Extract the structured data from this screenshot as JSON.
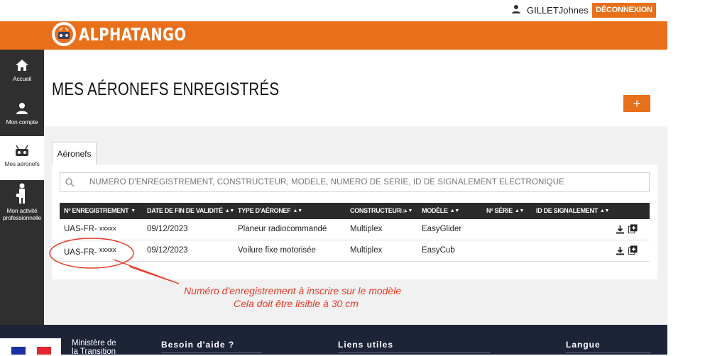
{
  "topbar": {
    "user_name": "GILLETJohnes",
    "logout_label": "DÉCONNEXION"
  },
  "header": {
    "logo_text": "ALPHATANGO"
  },
  "sidebar": {
    "items": [
      {
        "label": "Accueil",
        "icon": "home-icon"
      },
      {
        "label": "Mon compte",
        "icon": "user-icon"
      },
      {
        "label": "Mes aéronefs",
        "icon": "drone-icon"
      },
      {
        "label": "Mon activité professionnelle",
        "label_l1": "Mon activité",
        "label_l2": "professionnelle",
        "icon": "professional-icon"
      }
    ]
  },
  "main": {
    "title": "MES AÉRONEFS ENREGISTRÉS",
    "add_label": "+",
    "tab_label": "Aéronefs",
    "search_placeholder": "NUMÉRO D'ENREGISTREMENT, CONSTRUCTEUR, MODÈLE, NUMÉRO DE SÉRIE, ID DE SIGNALEMENT ÉLECTRONIQUE"
  },
  "table": {
    "columns": [
      "Nº ENREGISTREMENT",
      "DATE DE FIN DE VALIDITÉ",
      "TYPE D'AÉRONEF",
      "CONSTRUCTEUR",
      "MODÈLE",
      "Nº SÉRIE",
      "ID DE SIGNALEMENT"
    ],
    "ghost_text": "xte",
    "rows": [
      {
        "reg_prefix": "UAS-FR-",
        "reg_mask": "xxxxx",
        "date": "09/12/2023",
        "type": "Planeur radiocommandé",
        "maker": "Multiplex",
        "model": "EasyGlider",
        "serial": "",
        "signal_id": ""
      },
      {
        "reg_prefix": "UAS-FR-",
        "reg_mask": "xxxxx",
        "date": "09/12/2023",
        "type": "Voilure fixe motorisée",
        "maker": "Multiplex",
        "model": "EasyCub",
        "serial": "",
        "signal_id": ""
      }
    ]
  },
  "annotation": {
    "line1": "Numéro d'enregistrement à inscrire sur le modèle",
    "line2": "Cela doit être lisible à 30 cm",
    "color": "#e63a25"
  },
  "footer": {
    "ministry_l1": "Ministère de",
    "ministry_l2": "la Transition",
    "help_title": "Besoin d'aide ?",
    "links_title": "Liens utiles",
    "lang_title": "Langue"
  },
  "colors": {
    "accent": "#e8701b",
    "sidebar": "#2f2f2f",
    "footer": "#1d2438",
    "table_header": "#2b2b2b"
  }
}
